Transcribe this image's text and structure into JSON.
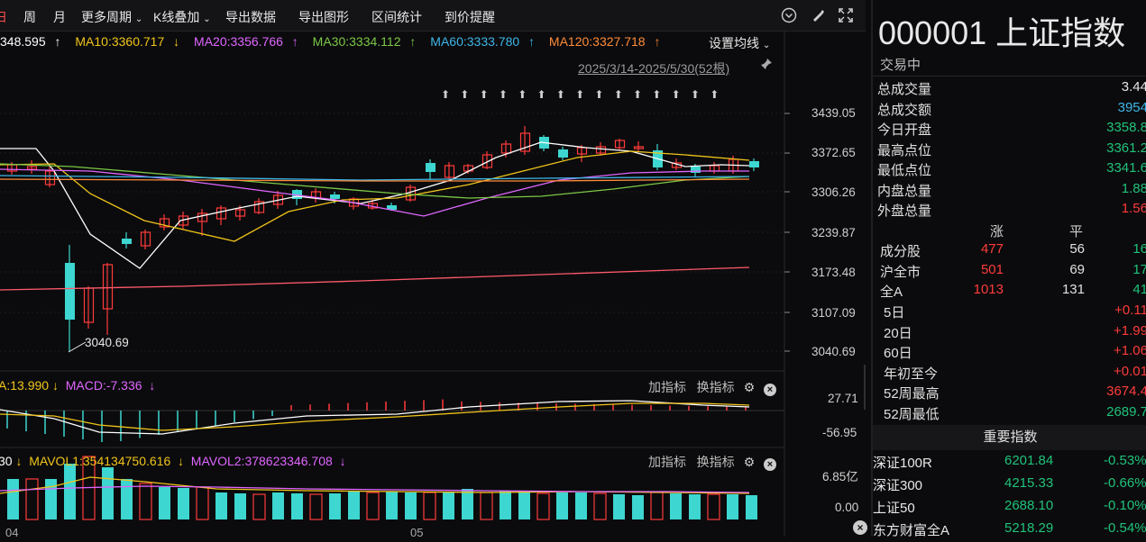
{
  "toolbar": {
    "items": [
      "日",
      "周",
      "月",
      "更多周期",
      "K线叠加",
      "导出数据",
      "导出图形",
      "区间统计",
      "到价提醒"
    ]
  },
  "ma_legend": {
    "ma5": "348.595",
    "ma10": "MA10:3360.717",
    "ma20": "MA20:3356.766",
    "ma30": "MA30:3334.112",
    "ma60": "MA60:3333.780",
    "ma120": "MA120:3327.718",
    "arrows": [
      "↑",
      "↓",
      "↑",
      "↑",
      "↑",
      "↑"
    ],
    "colors": {
      "ma5": "#ffffff",
      "ma10": "#f0c419",
      "ma20": "#e066ff",
      "ma30": "#7cc845",
      "ma60": "#3fb6e8",
      "ma120": "#ff8c3a"
    },
    "set_label": "设置均线",
    "range_label": "2025/3/14-2025/5/30(52根)"
  },
  "price_axis": [
    "3439.05",
    "3372.65",
    "3306.26",
    "3239.87",
    "3173.48",
    "3107.09",
    "3040.69"
  ],
  "low_annotation": "3040.69",
  "macd": {
    "dif": "A:13.990",
    "dif_arrow": "↓",
    "macd": "MACD:-7.336",
    "macd_arrow": "↓",
    "top": "27.71",
    "bottom": "-56.95"
  },
  "vol": {
    "v0": "30",
    "v0_arrow": "↓",
    "mavol1": "MAVOL1:354134750.616",
    "mavol1_arrow": "↓",
    "mavol2": "MAVOL2:378623346.708",
    "mavol2_arrow": "↓",
    "top": "6.85亿",
    "bottom": "0.00"
  },
  "subtools": {
    "add": "加指标",
    "switch": "换指标"
  },
  "x_ticks": [
    "04",
    "05"
  ],
  "quote": {
    "title": "000001 上证指数",
    "status": "交易中",
    "stats": [
      {
        "label": "总成交量",
        "value": "3.44",
        "color": "white"
      },
      {
        "label": "总成交额",
        "value": "3954",
        "color": "cyan"
      },
      {
        "label": "今日开盘",
        "value": "3358.8",
        "color": "green"
      },
      {
        "label": "最高点位",
        "value": "3361.2",
        "color": "green"
      },
      {
        "label": "最低点位",
        "value": "3341.6",
        "color": "green"
      },
      {
        "label": "内盘总量",
        "value": "1.88",
        "color": "green"
      },
      {
        "label": "外盘总量",
        "value": "1.56",
        "color": "red"
      }
    ],
    "breadth_head": [
      "涨",
      "平"
    ],
    "breadth": [
      {
        "label": "成分股",
        "up": "477",
        "flat": "56",
        "down": "16"
      },
      {
        "label": "沪全市",
        "up": "501",
        "flat": "69",
        "down": "17"
      },
      {
        "label": "全A",
        "up": "1013",
        "flat": "131",
        "down": "41"
      }
    ],
    "periods": [
      {
        "label": "5日",
        "value": "+0.11",
        "color": "red"
      },
      {
        "label": "20日",
        "value": "+1.99",
        "color": "red"
      },
      {
        "label": "60日",
        "value": "+1.06",
        "color": "red"
      },
      {
        "label": "年初至今",
        "value": "+0.01",
        "color": "red"
      },
      {
        "label": "52周最高",
        "value": "3674.4",
        "color": "red"
      },
      {
        "label": "52周最低",
        "value": "2689.7",
        "color": "green"
      }
    ],
    "index_header": "重要指数",
    "indices": [
      {
        "name": "深证100R",
        "value": "6201.84",
        "change": "-0.53%"
      },
      {
        "name": "深证300",
        "value": "4215.33",
        "change": "-0.66%"
      },
      {
        "name": "上证50",
        "value": "2688.10",
        "change": "-0.10%"
      },
      {
        "name": "东方财富全A",
        "value": "5218.29",
        "change": "-0.54%"
      }
    ]
  }
}
